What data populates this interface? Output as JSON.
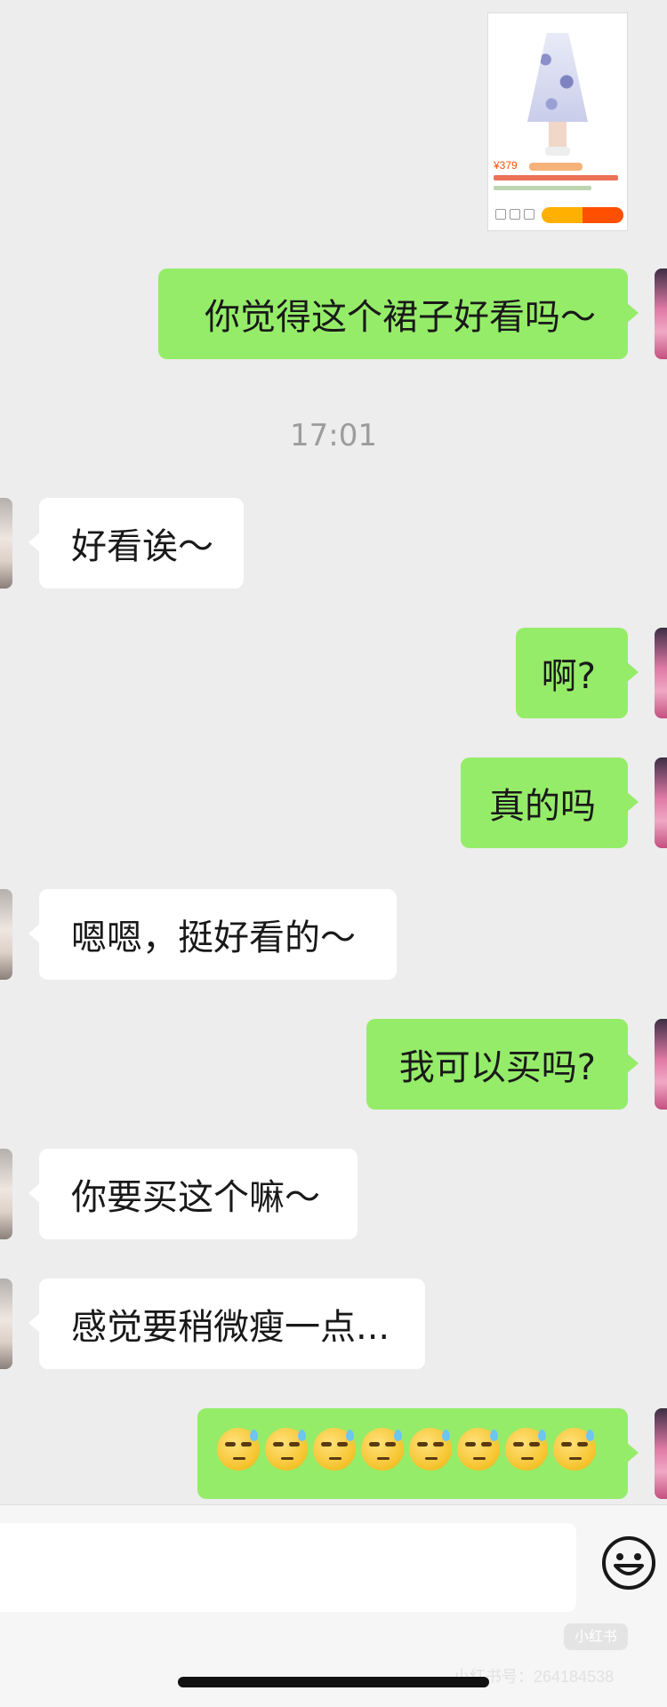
{
  "product_card": {
    "price": "¥379"
  },
  "messages": [
    {
      "side": "sent",
      "text": "你觉得这个裙子好看吗～"
    },
    {
      "side": "recv",
      "text": "好看诶～"
    },
    {
      "side": "sent",
      "text": "啊?"
    },
    {
      "side": "sent",
      "text": "真的吗"
    },
    {
      "side": "recv",
      "text": "嗯嗯，挺好看的～"
    },
    {
      "side": "sent",
      "text": "我可以买吗?"
    },
    {
      "side": "recv",
      "text": "你要买这个嘛～"
    },
    {
      "side": "recv",
      "text": "感觉要稍微瘦一点..."
    },
    {
      "side": "sent",
      "emoji": "sweat-smile-emoji",
      "count": 8
    }
  ],
  "timestamp": "17:01",
  "input_bar": {
    "emoji_button_icon": "smiley-face-icon"
  },
  "watermark": {
    "logo": "小红书",
    "text": "小红书号：264184538"
  },
  "colors": {
    "sent_bubble": "#95ec69",
    "recv_bubble": "#ffffff",
    "background": "#ededed",
    "price": "#ff5000"
  }
}
